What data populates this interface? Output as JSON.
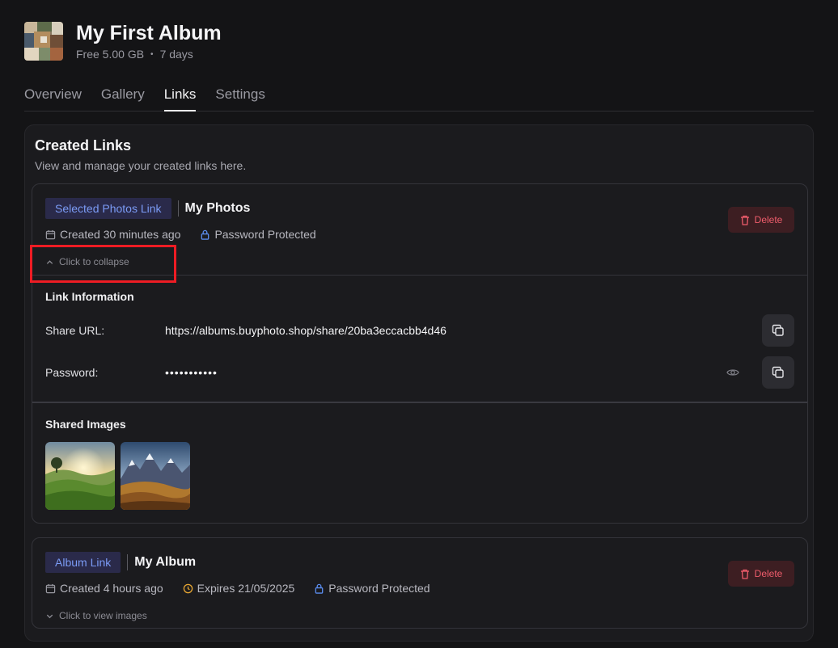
{
  "album": {
    "title": "My First Album",
    "storage": "Free 5.00 GB",
    "separator": "•",
    "duration": "7 days"
  },
  "tabs": [
    {
      "label": "Overview",
      "active": false
    },
    {
      "label": "Gallery",
      "active": false
    },
    {
      "label": "Links",
      "active": true
    },
    {
      "label": "Settings",
      "active": false
    }
  ],
  "panel": {
    "title": "Created Links",
    "subtitle": "View and manage your created links here."
  },
  "links": [
    {
      "type_badge": "Selected Photos Link",
      "name": "My Photos",
      "created": "Created 30 minutes ago",
      "protection": "Password Protected",
      "toggle_label": "Click to collapse",
      "delete_label": "Delete",
      "link_info_title": "Link Information",
      "share_url_label": "Share URL:",
      "share_url": "https://albums.buyphoto.shop/share/20ba3eccacbb4d46",
      "password_label": "Password:",
      "password_masked": "•••••••••••",
      "shared_images_title": "Shared Images"
    },
    {
      "type_badge": "Album Link",
      "name": "My Album",
      "created": "Created 4 hours ago",
      "expires": "Expires 21/05/2025",
      "protection": "Password Protected",
      "toggle_label": "Click to view images",
      "delete_label": "Delete"
    }
  ],
  "colors": {
    "accent_blue": "#7b9bf5",
    "delete_red": "#f05d6c",
    "expires_amber": "#e5a532",
    "highlight": "#ee1c24"
  }
}
